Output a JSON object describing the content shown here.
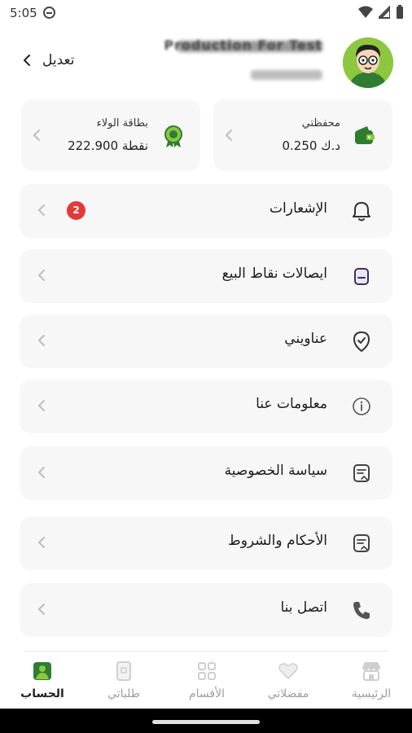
{
  "status_bar": {
    "time": "5:05"
  },
  "profile": {
    "name": "Production For Test",
    "edit_label": "تعديل"
  },
  "cards": {
    "wallet": {
      "title": "محفظتي",
      "value": "0.250 د.ك"
    },
    "loyalty": {
      "title": "بطاقة الولاء",
      "value": "222.900 نقطة"
    }
  },
  "menu": {
    "items": [
      {
        "label": "الإشعارات",
        "icon": "bell-icon",
        "badge": "2"
      },
      {
        "label": "ايصالات نقاط البيع",
        "icon": "receipt-icon"
      },
      {
        "label": "عناويني",
        "icon": "location-check-icon"
      },
      {
        "label": "معلومات عنا",
        "icon": "info-icon"
      },
      {
        "label": "سياسة الخصوصية",
        "icon": "document-icon"
      },
      {
        "label": "الأحكام والشروط",
        "icon": "document-icon"
      },
      {
        "label": "اتصل بنا",
        "icon": "phone-icon"
      }
    ]
  },
  "bottom_nav": {
    "items": [
      {
        "label": "الرئيسية",
        "icon": "store-icon",
        "active": false
      },
      {
        "label": "مفضلاتي",
        "icon": "heart-icon",
        "active": false
      },
      {
        "label": "الأقسام",
        "icon": "grid-icon",
        "active": false
      },
      {
        "label": "طلباتي",
        "icon": "orders-icon",
        "active": false
      },
      {
        "label": "الحساب",
        "icon": "profile-icon",
        "active": true
      }
    ]
  },
  "colors": {
    "brand_green": "#2e7d32",
    "avatar_bg": "#8dc63f",
    "badge_red": "#e53935",
    "card_bg": "#f7f7f7",
    "inactive": "#9e9e9e"
  }
}
